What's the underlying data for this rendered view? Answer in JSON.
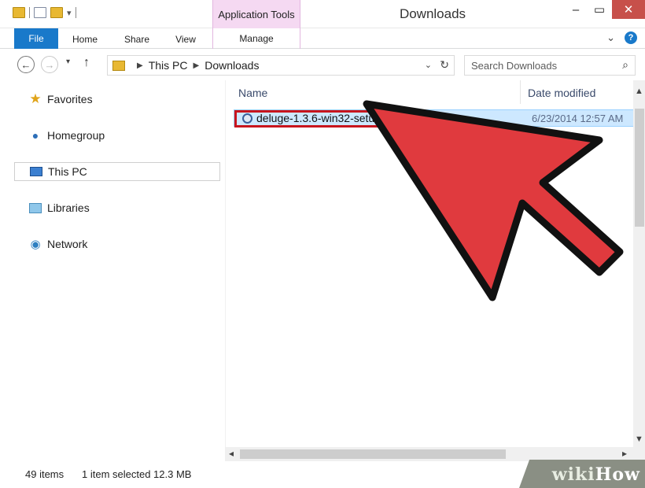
{
  "window": {
    "title": "Downloads",
    "context_tab": "Application Tools"
  },
  "ribbon": {
    "tabs": [
      "File",
      "Home",
      "Share",
      "View",
      "Manage"
    ]
  },
  "address": {
    "crumbs": [
      "This PC",
      "Downloads"
    ]
  },
  "search": {
    "placeholder": "Search Downloads"
  },
  "nav_pane": {
    "items": [
      "Favorites",
      "Homegroup",
      "This PC",
      "Libraries",
      "Network"
    ],
    "selected": "This PC"
  },
  "columns": {
    "name": "Name",
    "date": "Date modified"
  },
  "files": [
    {
      "name": "deluge-1.3.6-win32-setup",
      "date": "6/23/2014 12:57 AM",
      "selected": true
    }
  ],
  "status": {
    "count": "49 items",
    "selection": "1 item selected  12.3 MB"
  },
  "watermark": {
    "text_a": "wiki",
    "text_b": "How"
  },
  "colors": {
    "accent": "#1979ca",
    "highlight_border": "#c8151d",
    "selection_fill": "#cde8ff",
    "context_tab": "#f5d9f2",
    "arrow_fill": "#e03a3e"
  },
  "icons": [
    "folder-icon",
    "back-icon",
    "forward-icon",
    "up-icon",
    "refresh-icon",
    "search-icon",
    "star-icon",
    "homegroup-icon",
    "computer-icon",
    "libraries-icon",
    "network-icon",
    "installer-icon",
    "help-icon",
    "close-icon",
    "minimize-icon",
    "maximize-icon"
  ]
}
